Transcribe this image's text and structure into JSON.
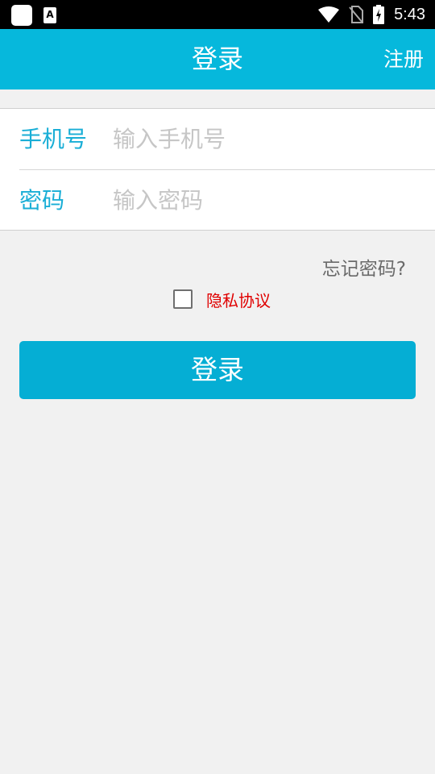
{
  "status_bar": {
    "time": "5:43",
    "app_icon_letter": "A",
    "icons": [
      "app-square-icon",
      "font-a-icon",
      "wifi-icon",
      "no-sim-icon",
      "battery-charging-icon"
    ]
  },
  "app_bar": {
    "title": "登录",
    "register_label": "注册",
    "color": "#06b8dc"
  },
  "form": {
    "phone": {
      "label": "手机号",
      "placeholder": "输入手机号",
      "value": ""
    },
    "password": {
      "label": "密码",
      "placeholder": "输入密码",
      "value": ""
    }
  },
  "forgot_password": "忘记密码?",
  "privacy": {
    "checked": false,
    "label": "隐私协议",
    "color": "#e00000"
  },
  "login_button": {
    "label": "登录",
    "color": "#05aed4"
  }
}
